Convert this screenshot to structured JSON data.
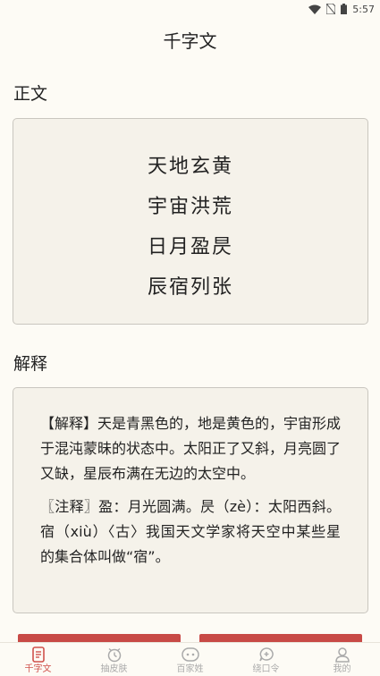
{
  "status": {
    "time": "5:57"
  },
  "header": {
    "title": "千字文"
  },
  "main": {
    "heading": "正文",
    "lines": [
      "天地玄黄",
      "宇宙洪荒",
      "日月盈昃",
      "辰宿列张"
    ]
  },
  "explain": {
    "heading": "解释",
    "paragraphs": [
      "【解释】天是青黑色的，地是黄色的，宇宙形成于混沌蒙昧的状态中。太阳正了又斜，月亮圆了又缺，星辰布满在无边的太空中。",
      "〖注释〗盈：月光圆满。昃（zè）：太阳西斜。宿（xiù）〈古〉我国天文学家将天空中某些星的集合体叫做“宿”。"
    ]
  },
  "tabs": [
    {
      "label": "千字文",
      "icon": "document-icon",
      "active": true
    },
    {
      "label": "抽皮肤",
      "icon": "alarm-clock-icon",
      "active": false
    },
    {
      "label": "百家姓",
      "icon": "face-icon",
      "active": false
    },
    {
      "label": "绕口令",
      "icon": "chat-heart-icon",
      "active": false
    },
    {
      "label": "我的",
      "icon": "person-icon",
      "active": false
    }
  ],
  "colors": {
    "accent": "#d0534d",
    "background": "#fdfbf5",
    "card": "#f5f2ea"
  }
}
